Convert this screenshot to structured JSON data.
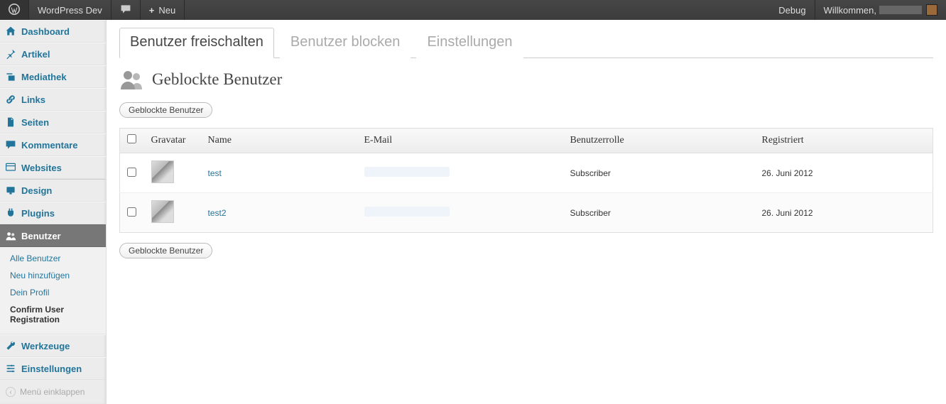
{
  "adminbar": {
    "site_title": "WordPress Dev",
    "new_label": "Neu",
    "debug_label": "Debug",
    "welcome_label": "Willkommen,"
  },
  "sidebar": {
    "items": [
      {
        "id": "dashboard",
        "label": "Dashboard",
        "icon": "home"
      },
      {
        "id": "artikel",
        "label": "Artikel",
        "icon": "pin"
      },
      {
        "id": "mediathek",
        "label": "Mediathek",
        "icon": "media"
      },
      {
        "id": "links",
        "label": "Links",
        "icon": "link"
      },
      {
        "id": "seiten",
        "label": "Seiten",
        "icon": "page"
      },
      {
        "id": "kommentare",
        "label": "Kommentare",
        "icon": "comment"
      },
      {
        "id": "websites",
        "label": "Websites",
        "icon": "sites"
      },
      {
        "id": "design",
        "label": "Design",
        "icon": "appearance",
        "sep": true
      },
      {
        "id": "plugins",
        "label": "Plugins",
        "icon": "plugin"
      },
      {
        "id": "benutzer",
        "label": "Benutzer",
        "icon": "users",
        "current": true
      },
      {
        "id": "werkzeuge",
        "label": "Werkzeuge",
        "icon": "tools"
      },
      {
        "id": "einstellungen",
        "label": "Einstellungen",
        "icon": "settings"
      }
    ],
    "submenu": [
      {
        "label": "Alle Benutzer"
      },
      {
        "label": "Neu hinzufügen"
      },
      {
        "label": "Dein Profil"
      },
      {
        "label": "Confirm User Registration",
        "current": true
      }
    ],
    "collapse_label": "Menü einklappen"
  },
  "tabs": [
    {
      "label": "Benutzer freischalten",
      "active": true
    },
    {
      "label": "Benutzer blocken"
    },
    {
      "label": "Einstellungen"
    }
  ],
  "page": {
    "title": "Geblockte Benutzer",
    "bulk_button_label": "Geblockte Benutzer"
  },
  "table": {
    "columns": {
      "gravatar": "Gravatar",
      "name": "Name",
      "email": "E-Mail",
      "role": "Benutzerrolle",
      "registered": "Registriert"
    },
    "rows": [
      {
        "name": "test",
        "email": "",
        "role": "Subscriber",
        "registered": "26. Juni 2012"
      },
      {
        "name": "test2",
        "email": "",
        "role": "Subscriber",
        "registered": "26. Juni 2012"
      }
    ]
  }
}
